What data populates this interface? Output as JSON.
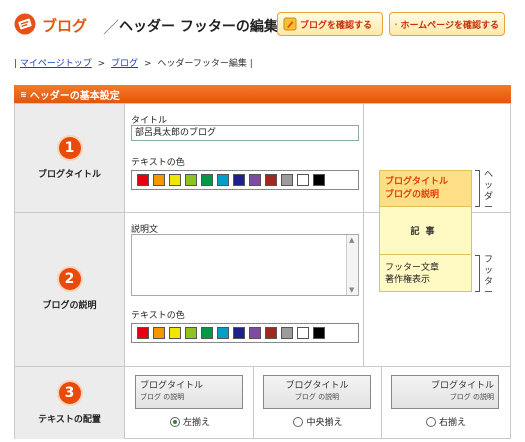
{
  "header": {
    "brand": "ブログ",
    "slash": "／",
    "title": "ヘッダー フッターの編集",
    "btn_blog": "ブログを確認する",
    "btn_home": "ホームページを確認する"
  },
  "breadcrumb": {
    "lead": "|",
    "items": [
      "マイページトップ",
      "ブログ",
      "ヘッダーフッター編集"
    ],
    "sep": ">",
    "tail": "|"
  },
  "section": {
    "title": "ヘッダーの基本設定"
  },
  "rows": [
    {
      "number": "1",
      "label": "ブログタイトル"
    },
    {
      "number": "2",
      "label": "ブログの説明"
    },
    {
      "number": "3",
      "label": "テキストの配置"
    }
  ],
  "title_field": {
    "label": "タイトル",
    "value": "部呂具太郎のブログ"
  },
  "desc_field": {
    "label": "説明文",
    "value": ""
  },
  "color_label": "テキストの色",
  "palette": [
    "#e60012",
    "#f39800",
    "#f4e500",
    "#8fc31f",
    "#009944",
    "#00a0c6",
    "#1d2088",
    "#7d4ba0",
    "#a0291f",
    "#9c9c9c",
    "#ffffff",
    "#000000"
  ],
  "preview": {
    "blog_title": "ブログタイトル",
    "blog_desc": "ブログの説明",
    "article": "記事",
    "footer_text": "フッター文章",
    "copyright": "著作権表示",
    "header_label": "ヘッダー",
    "footer_label": "フッター"
  },
  "alignment": {
    "options": [
      {
        "title": "ブログタイトル",
        "sub": "ブログ の説明",
        "label": "左揃え",
        "align": "left",
        "selected": true
      },
      {
        "title": "ブログタイトル",
        "sub": "ブログ の説明",
        "label": "中央揃え",
        "align": "center",
        "selected": false
      },
      {
        "title": "ブログタイトル",
        "sub": "ブログ の説明",
        "label": "右揃え",
        "align": "right",
        "selected": false
      }
    ]
  }
}
